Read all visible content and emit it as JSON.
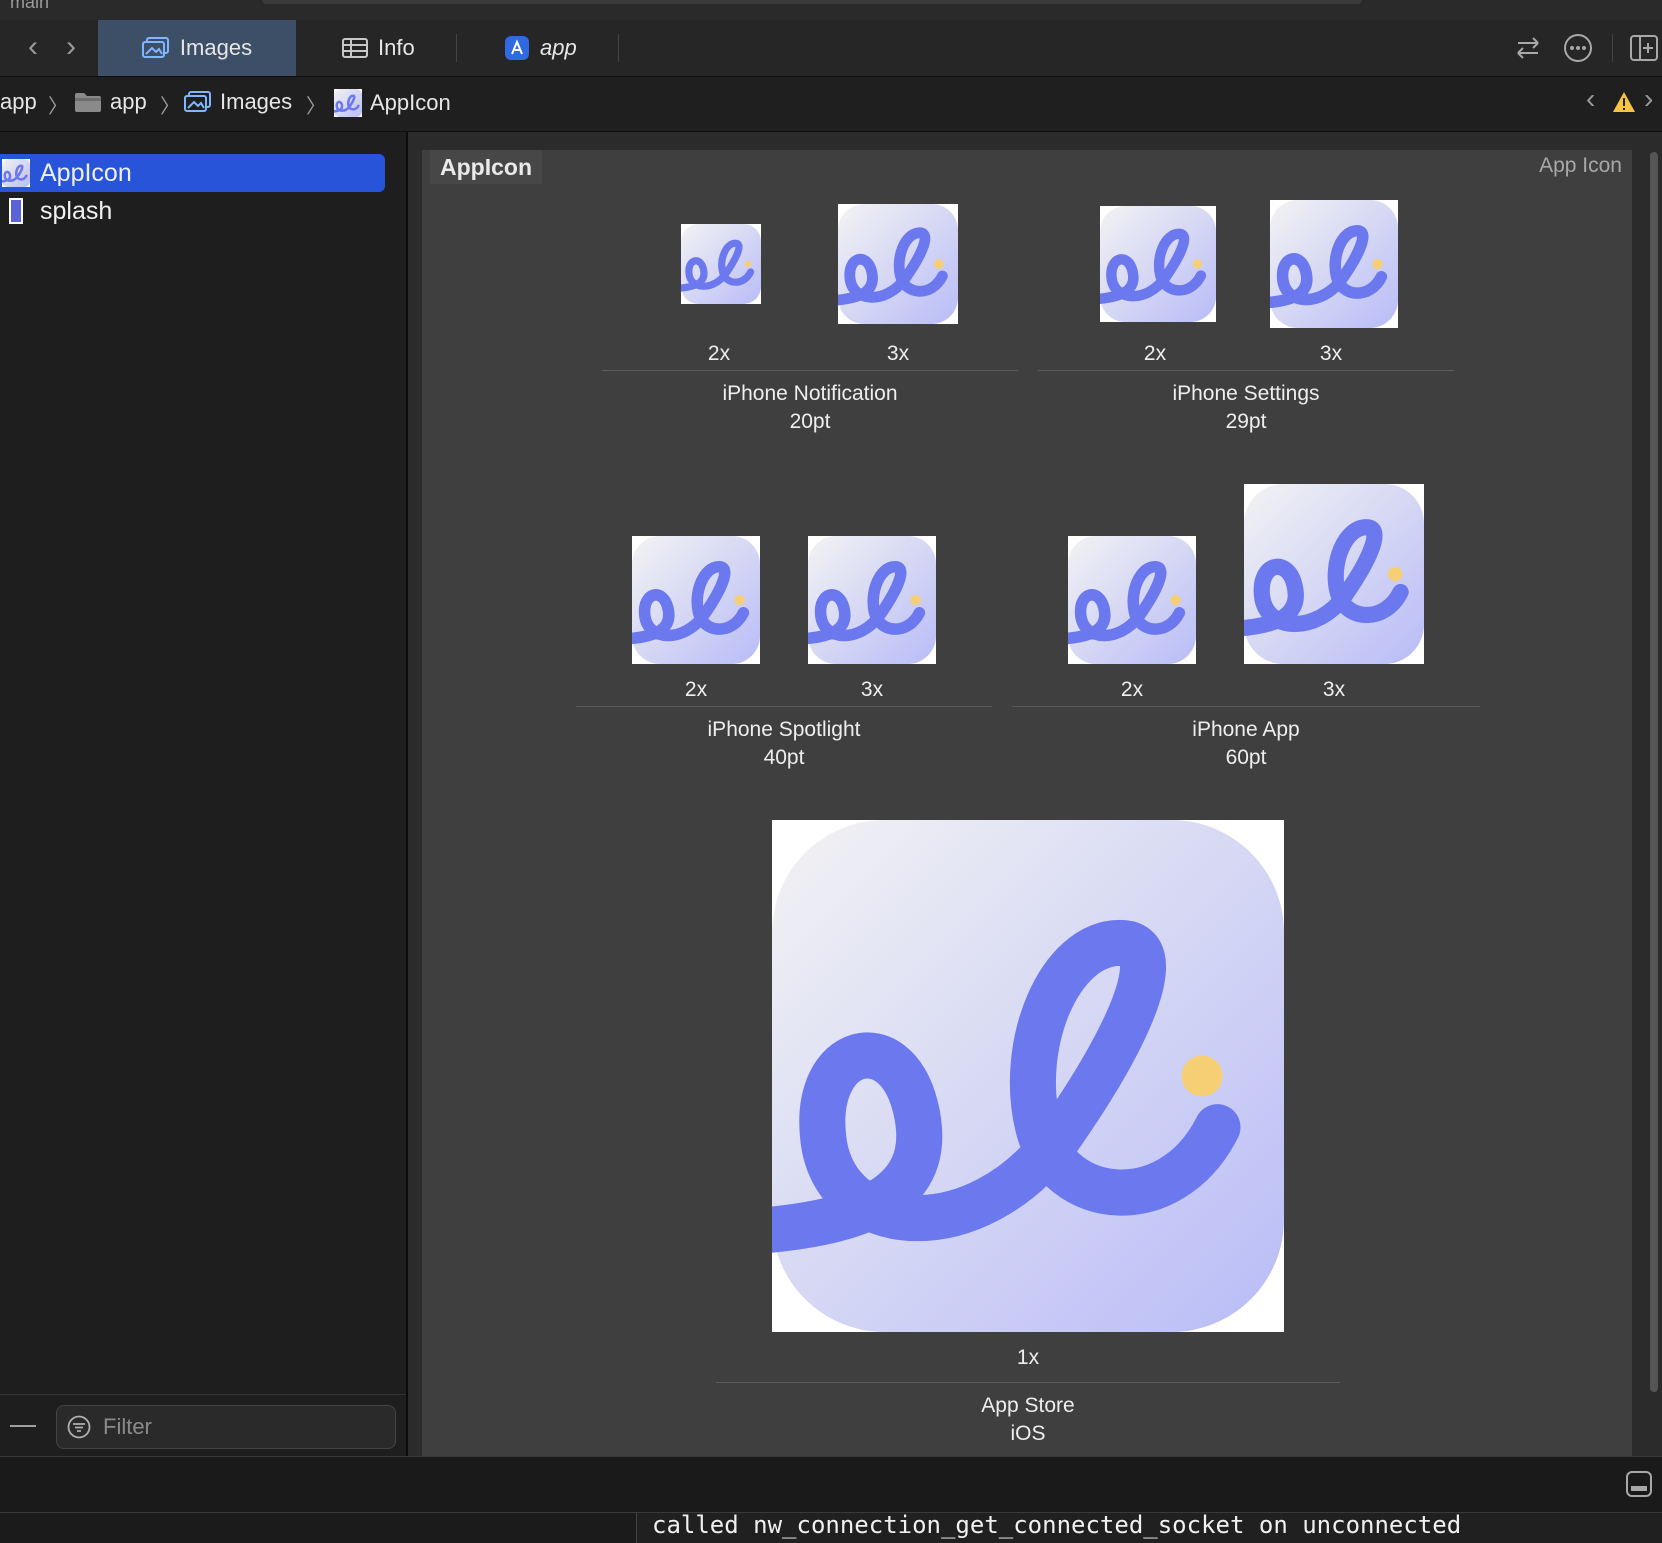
{
  "window": {
    "title": "main"
  },
  "tabbar": {
    "tabs": [
      {
        "label": "Images",
        "active": true
      },
      {
        "label": "Info",
        "active": false
      },
      {
        "label": "app",
        "active": false
      }
    ]
  },
  "breadcrumb": [
    "app",
    "app",
    "Images",
    "AppIcon"
  ],
  "sidebar": {
    "items": [
      {
        "label": "AppIcon",
        "selected": true
      },
      {
        "label": "splash",
        "selected": false
      }
    ],
    "filter_placeholder": "Filter"
  },
  "editor": {
    "title": "AppIcon",
    "type_label": "App Icon",
    "groups": [
      {
        "name": "iPhone Notification",
        "size": "20pt",
        "scales": [
          "2x",
          "3x"
        ]
      },
      {
        "name": "iPhone Settings",
        "size": "29pt",
        "scales": [
          "2x",
          "3x"
        ]
      },
      {
        "name": "iPhone Spotlight",
        "size": "40pt",
        "scales": [
          "2x",
          "3x"
        ]
      },
      {
        "name": "iPhone App",
        "size": "60pt",
        "scales": [
          "2x",
          "3x"
        ]
      },
      {
        "name": "App Store",
        "size": "iOS",
        "scales": [
          "1x"
        ]
      }
    ]
  },
  "console": {
    "message": "called nw_connection_get_connected_socket on unconnected"
  },
  "colors": {
    "accent": "#2754d8",
    "icon_stroke": "#6b78ee",
    "icon_dot": "#f6cf74"
  },
  "icons": [
    "chevron-left-icon",
    "chevron-right-icon",
    "images-icon",
    "table-icon",
    "app-icon",
    "swap-icon",
    "more-icon",
    "panel-icon",
    "folder-icon",
    "warning-icon",
    "filter-icon",
    "minus-icon"
  ]
}
